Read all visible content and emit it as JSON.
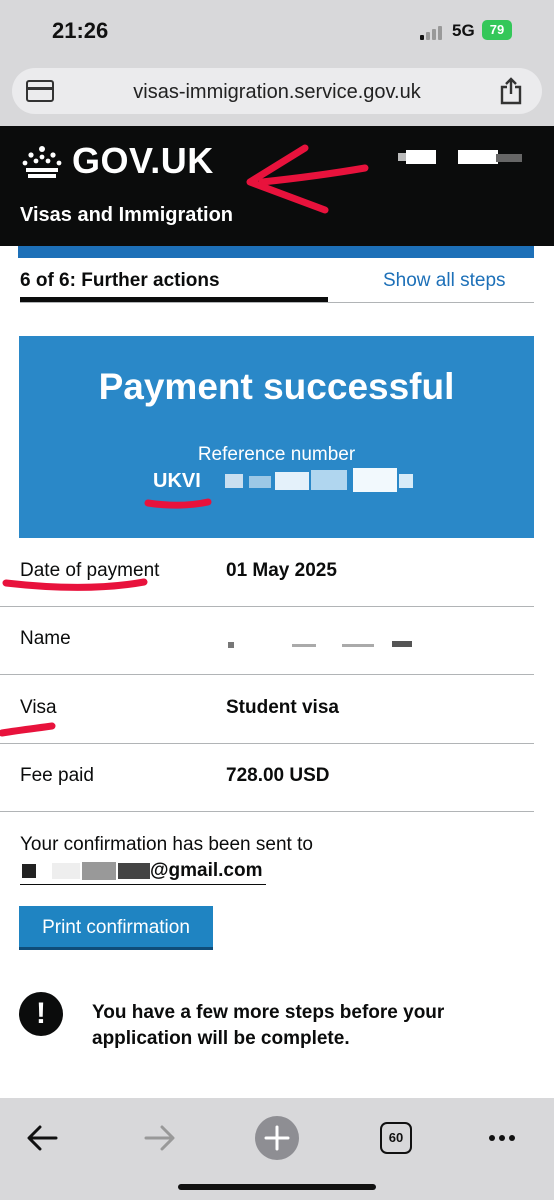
{
  "status_bar": {
    "time": "21:26",
    "network": "5G",
    "battery": "79"
  },
  "browser": {
    "url": "visas-immigration.service.gov.uk",
    "tab_count": "60"
  },
  "header": {
    "logo_text": "GOV.UK",
    "service_name": "Visas and Immigration"
  },
  "step_nav": {
    "current_step": "6 of 6: Further actions",
    "show_all": "Show all steps"
  },
  "panel": {
    "title": "Payment successful",
    "reference_label": "Reference number",
    "reference_prefix": "UKVI"
  },
  "summary": [
    {
      "key": "Date of payment",
      "value": "01 May 2025"
    },
    {
      "key": "Name",
      "value": ""
    },
    {
      "key": "Visa",
      "value": "Student visa"
    },
    {
      "key": "Fee paid",
      "value": "728.00 USD"
    }
  ],
  "confirmation": {
    "text": "Your confirmation has been sent to",
    "email_suffix": "@gmail.com"
  },
  "print_button": "Print confirmation",
  "warning": {
    "text": "You have a few more steps before your application will be complete."
  },
  "colors": {
    "gov_blue": "#1d70b8",
    "panel_blue": "#2a88c8",
    "header_black": "#0b0c0c",
    "annotation_red": "#e8123c"
  }
}
